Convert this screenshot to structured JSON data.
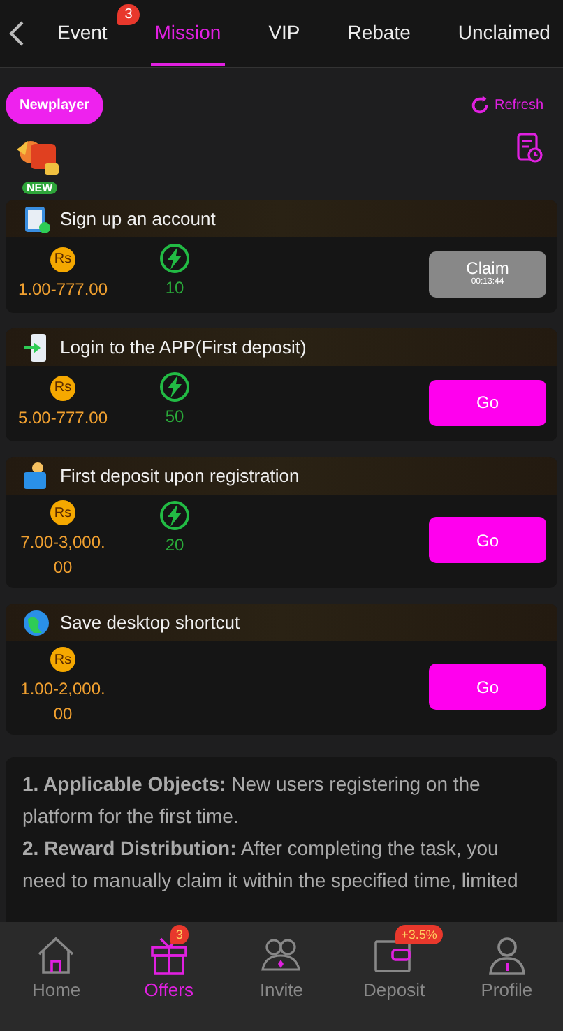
{
  "top_tabs": [
    {
      "label": "Event",
      "selected": false,
      "badge": "3"
    },
    {
      "label": "Mission",
      "selected": true
    },
    {
      "label": "VIP",
      "selected": false
    },
    {
      "label": "Rebate",
      "selected": false
    },
    {
      "label": "Unclaimed",
      "selected": false
    }
  ],
  "category": {
    "label": "Newplayer",
    "selected": true
  },
  "refresh": "Refresh",
  "new_badge": "NEW",
  "tasks": [
    {
      "title": "Sign up an account",
      "coin_symbol": "Rs",
      "coins": "1.00-777.00",
      "energy": "10",
      "button": {
        "kind": "claim",
        "label": "Claim",
        "timer": "00:13:44"
      }
    },
    {
      "title": "Login to the APP(First deposit)",
      "coin_symbol": "Rs",
      "coins": "5.00-777.00",
      "energy": "50",
      "button": {
        "kind": "go",
        "label": "Go"
      }
    },
    {
      "title": "First deposit upon registration",
      "coin_symbol": "Rs",
      "coins": "7.00-3,000.00",
      "energy": "20",
      "button": {
        "kind": "go",
        "label": "Go"
      }
    },
    {
      "title": "Save desktop shortcut",
      "coin_symbol": "Rs",
      "coins": "1.00-2,000.00",
      "button": {
        "kind": "go",
        "label": "Go"
      }
    }
  ],
  "rules": [
    "**1. Applicable Objects:** New users registering on the platform for the first time.",
    "**2. Reward Distribution:** After completing the task, you need to manually claim it within the specified time, limited"
  ],
  "bottom_nav": [
    {
      "label": "Home",
      "selected": false
    },
    {
      "label": "Offers",
      "selected": true,
      "badge": "3"
    },
    {
      "label": "Invite",
      "selected": false
    },
    {
      "label": "Deposit",
      "selected": false,
      "badge": "+3.5%"
    },
    {
      "label": "Profile",
      "selected": false
    }
  ]
}
